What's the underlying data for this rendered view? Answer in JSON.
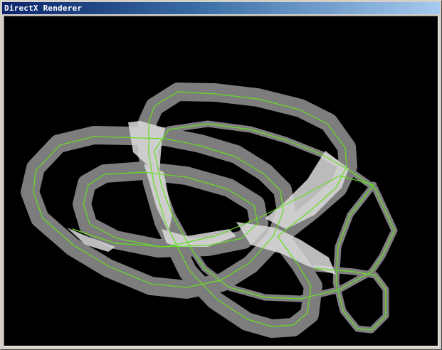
{
  "window": {
    "title": "DirectX Renderer"
  },
  "colors": {
    "titlebar_start": "#0a246a",
    "titlebar_end": "#a6caf0",
    "viewport_background": "#000000",
    "road_surface": "#808080",
    "road_highlight": "#dcdcdc",
    "centerline": "#66dd22"
  }
}
